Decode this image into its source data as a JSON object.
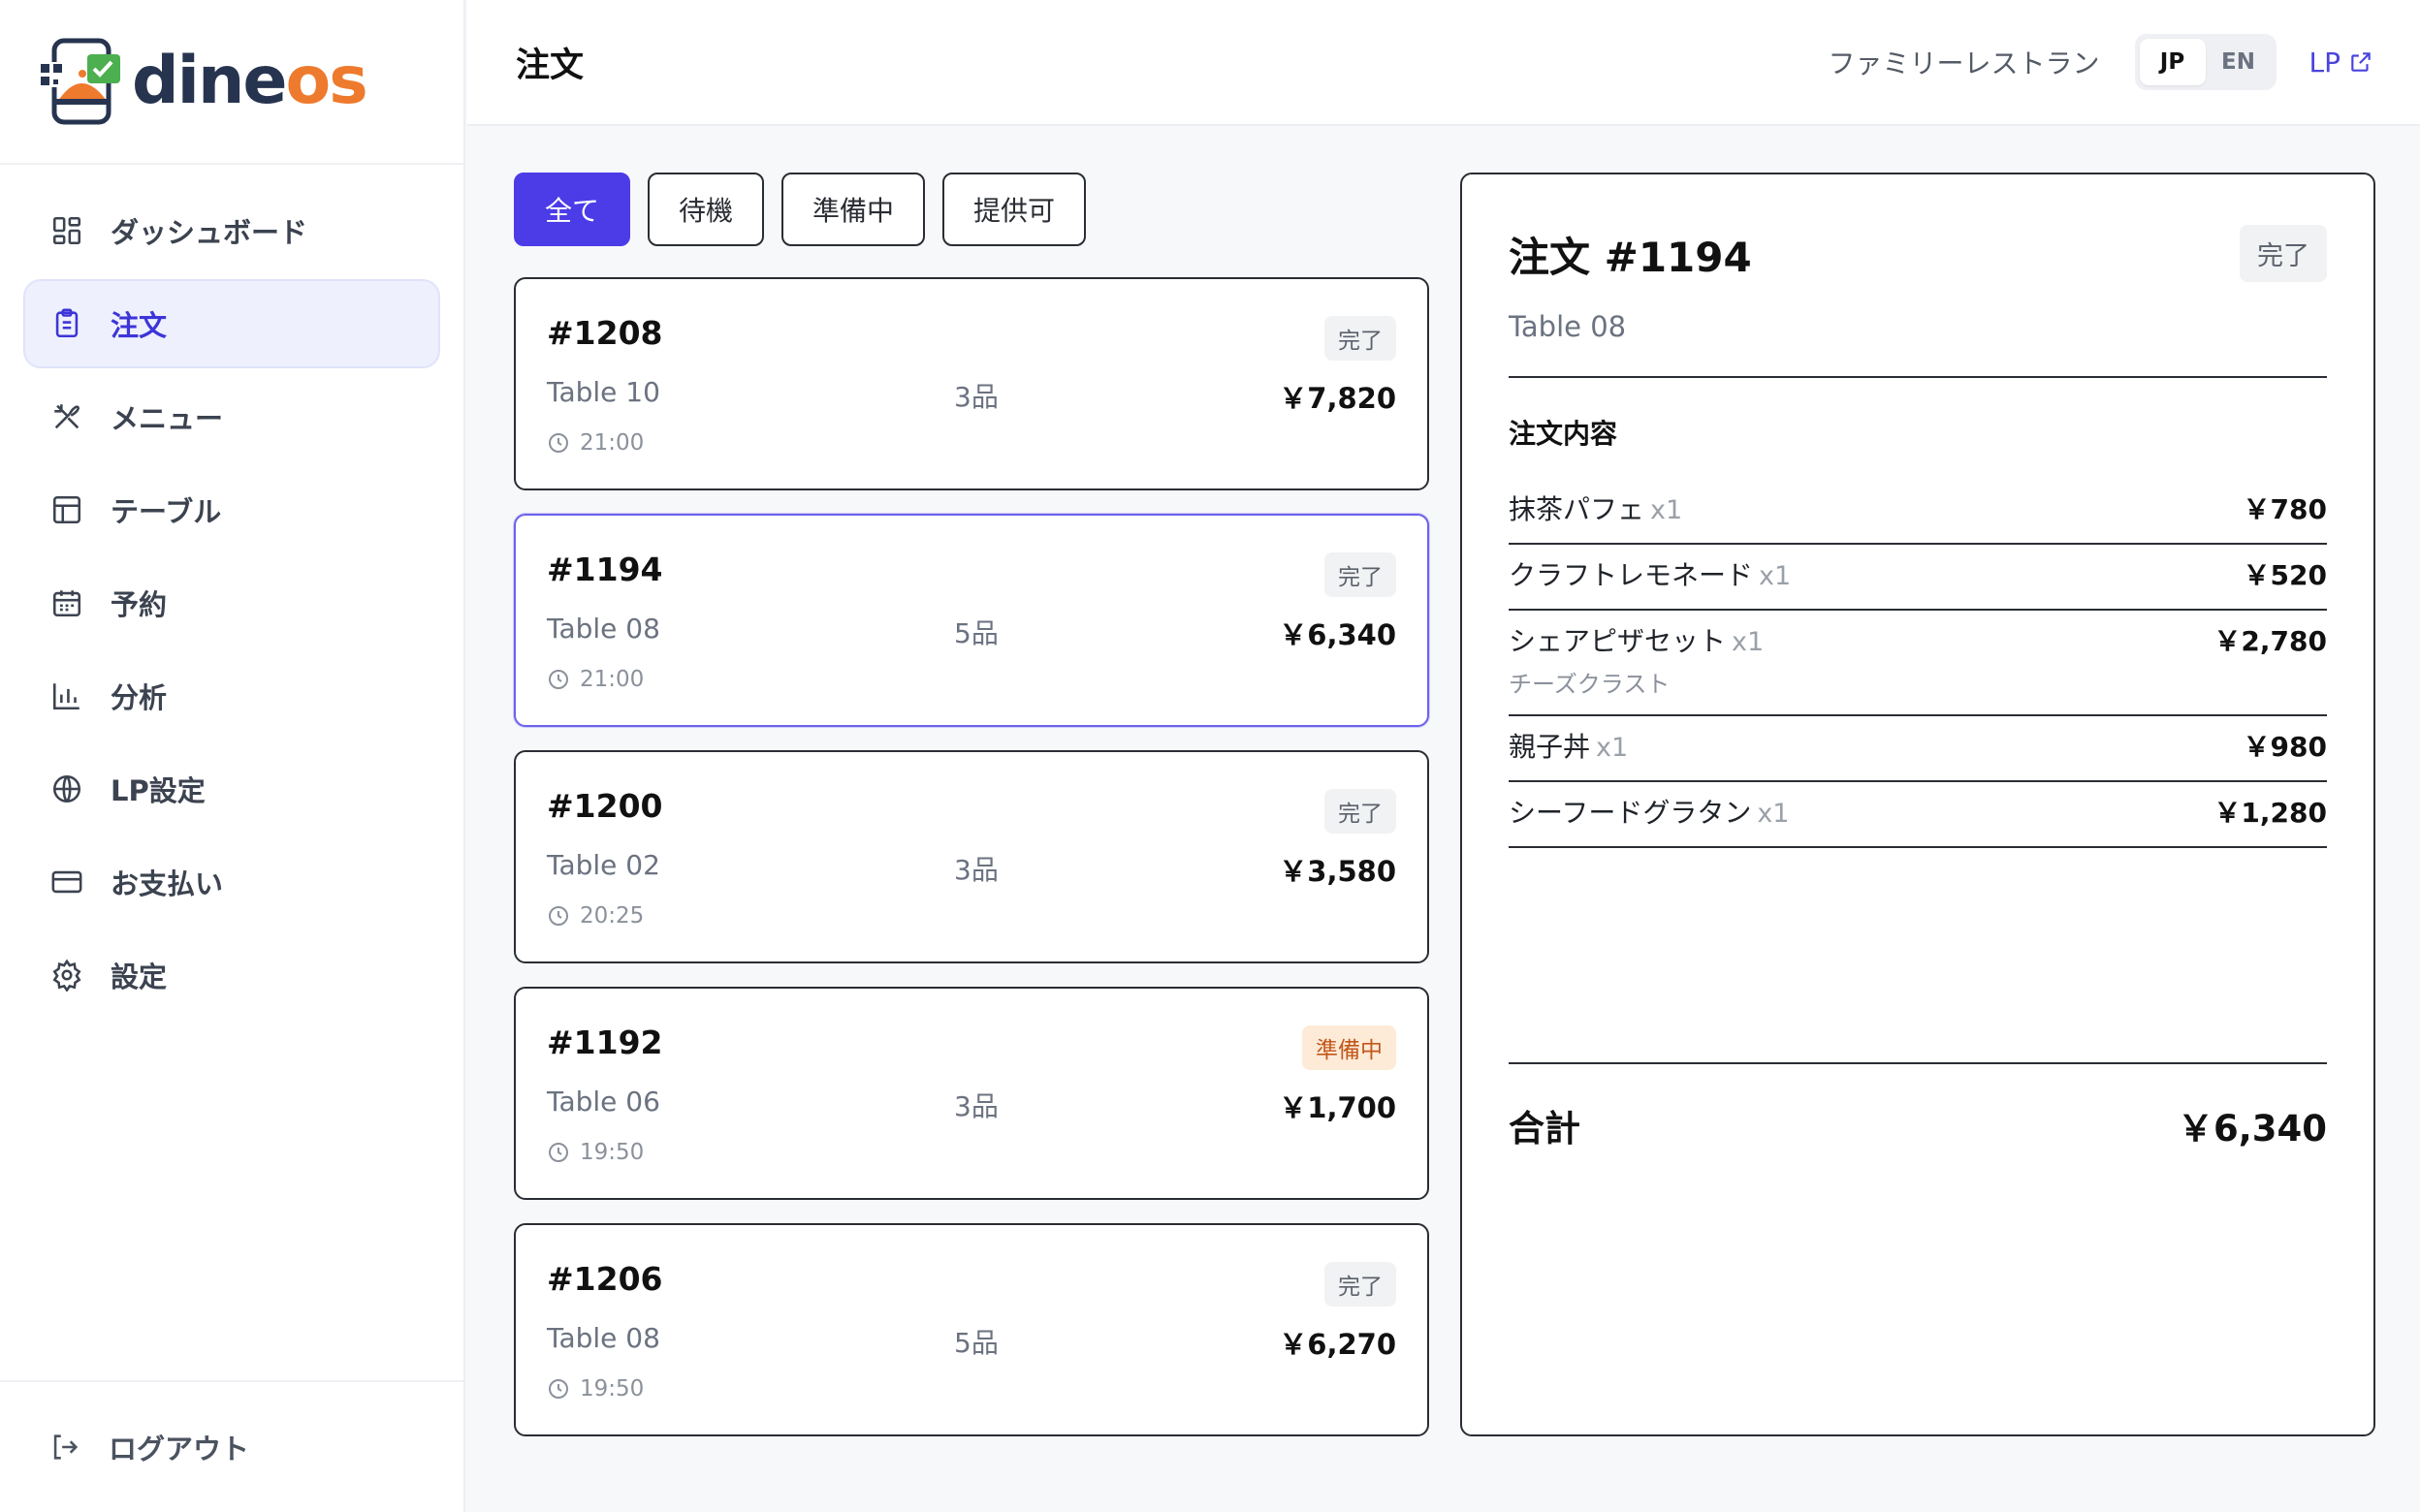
{
  "brand": {
    "name_part1": "dine",
    "name_part2": "os",
    "colors": {
      "dark": "#27344f",
      "orange": "#ee7a2d",
      "green": "#4caf50"
    }
  },
  "sidebar": {
    "items": [
      {
        "label": "ダッシュボード",
        "icon": "dashboard-grid-icon"
      },
      {
        "label": "注文",
        "icon": "clipboard-icon",
        "active": true
      },
      {
        "label": "メニュー",
        "icon": "utensils-icon"
      },
      {
        "label": "テーブル",
        "icon": "table-icon"
      },
      {
        "label": "予約",
        "icon": "calendar-icon"
      },
      {
        "label": "分析",
        "icon": "bar-chart-icon"
      },
      {
        "label": "LP設定",
        "icon": "globe-icon"
      },
      {
        "label": "お支払い",
        "icon": "credit-card-icon"
      },
      {
        "label": "設定",
        "icon": "gear-icon"
      }
    ],
    "logout_label": "ログアウト"
  },
  "header": {
    "title": "注文",
    "restaurant": "ファミリーレストラン",
    "lang_jp": "JP",
    "lang_en": "EN",
    "lp_link": "LP"
  },
  "filters": [
    "全て",
    "待機",
    "準備中",
    "提供可"
  ],
  "orders": [
    {
      "id": "#1208",
      "status": "完了",
      "table": "Table 10",
      "count": "3品",
      "total": "￥7,820",
      "time": "21:00"
    },
    {
      "id": "#1194",
      "status": "完了",
      "table": "Table 08",
      "count": "5品",
      "total": "￥6,340",
      "time": "21:00"
    },
    {
      "id": "#1200",
      "status": "完了",
      "table": "Table 02",
      "count": "3品",
      "total": "￥3,580",
      "time": "20:25"
    },
    {
      "id": "#1192",
      "status": "準備中",
      "table": "Table 06",
      "count": "3品",
      "total": "￥1,700",
      "time": "19:50"
    },
    {
      "id": "#1206",
      "status": "完了",
      "table": "Table 08",
      "count": "5品",
      "total": "￥6,270",
      "time": "19:50"
    }
  ],
  "detail": {
    "title": "注文 #1194",
    "status": "完了",
    "table": "Table 08",
    "section_title": "注文内容",
    "items": [
      {
        "name": "抹茶パフェ",
        "qty": "x1",
        "price": "￥780",
        "note": ""
      },
      {
        "name": "クラフトレモネード",
        "qty": "x1",
        "price": "￥520",
        "note": ""
      },
      {
        "name": "シェアピザセット",
        "qty": "x1",
        "price": "￥2,780",
        "note": "チーズクラスト"
      },
      {
        "name": "親子丼",
        "qty": "x1",
        "price": "￥980",
        "note": ""
      },
      {
        "name": "シーフードグラタン",
        "qty": "x1",
        "price": "￥1,280",
        "note": ""
      }
    ],
    "total_label": "合計",
    "total": "￥6,340"
  }
}
